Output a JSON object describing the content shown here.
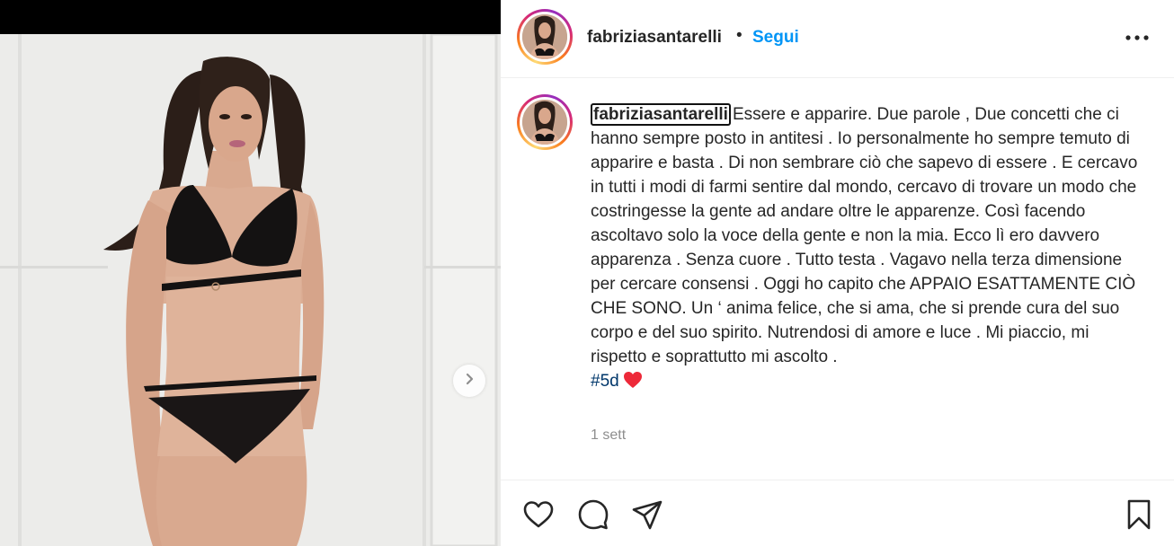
{
  "post": {
    "username": "fabriziasantarelli",
    "separator": "•",
    "follow_label": "Segui",
    "caption_user": "fabriziasantarelli",
    "caption_body": "Essere e apparire. Due parole , Due concetti che ci hanno sempre posto in antitesi . Io personalmente ho sempre temuto di apparire e basta . Di non sembrare ciò che sapevo di essere . E cercavo in tutti i modi di farmi sentire dal mondo, cercavo di trovare un modo che costringesse la gente ad andare oltre le apparenze. Così facendo ascoltavo solo la voce della gente e non la mia. Ecco lì ero davvero apparenza . Senza cuore . Tutto testa . Vagavo nella terza dimensione per cercare consensi . Oggi ho capito che APPAIO ESATTAMENTE CIÒ CHE SONO. Un ‘ anima felice, che si ama, che si prende cura del suo corpo e del suo spirito. Nutrendosi di amore e luce . Mi piaccio, mi rispetto e soprattutto mi ascolto .",
    "hashtag": "#5d",
    "time": "1 sett"
  },
  "icons": {
    "more": "more-options-icon",
    "next": "chevron-right-icon",
    "like": "heart-icon",
    "comment": "comment-icon",
    "share": "send-icon",
    "save": "bookmark-icon",
    "heart_emoji": "red-heart-emoji"
  },
  "colors": {
    "link_blue": "#0095f6",
    "hashtag": "#00376b",
    "muted": "#8e8e8e",
    "heart_red": "#ed2939"
  }
}
